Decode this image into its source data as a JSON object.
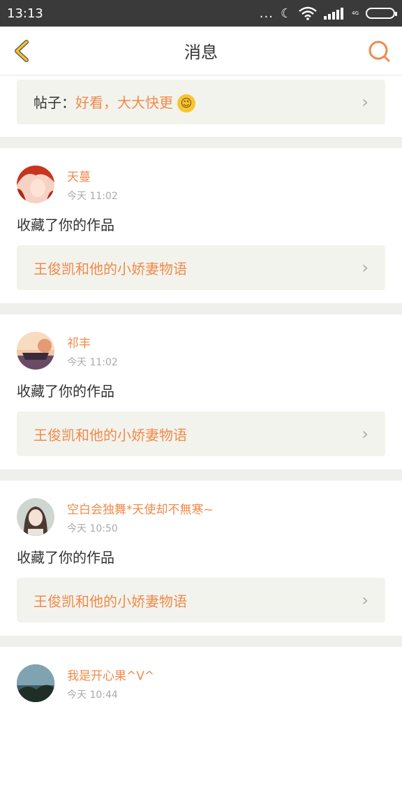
{
  "status_bar": {
    "time": "13:13",
    "dots": "...",
    "network": "4G"
  },
  "header": {
    "title": "消息"
  },
  "post": {
    "label": "帖子：",
    "text": "好看，大大快更",
    "emoji": "😉"
  },
  "messages": [
    {
      "username": "天蔓",
      "time": "今天 11:02",
      "action": "收藏了你的作品",
      "work": "王俊凯和他的小娇妻物语"
    },
    {
      "username": "祁丰",
      "time": "今天 11:02",
      "action": "收藏了你的作品",
      "work": "王俊凯和他的小娇妻物语"
    },
    {
      "username": "空白会独舞*天使却不無寒~",
      "time": "今天 10:50",
      "action": "收藏了你的作品",
      "work": "王俊凯和他的小娇妻物语"
    },
    {
      "username": "我是开心果^V^",
      "time": "今天 10:44"
    }
  ],
  "colors": {
    "accent": "#f08a4a",
    "status_bar": "#3a3a3a",
    "card_bg": "#f3f3ed",
    "back_arrow": "#f2c22e"
  }
}
